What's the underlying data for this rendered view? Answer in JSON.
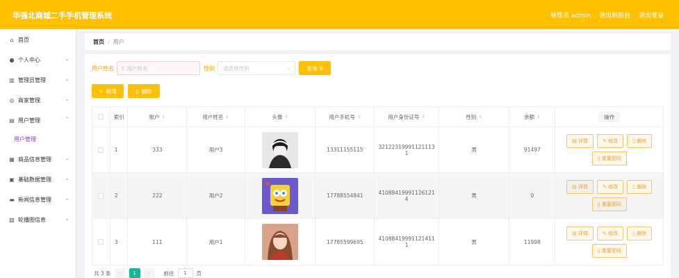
{
  "header": {
    "title": "华强北商城二手手机管理系统",
    "admin": "管理员 admin",
    "to_frontend": "退出到前台",
    "logout": "退出登录"
  },
  "sidebar": {
    "items": [
      {
        "label": "首页",
        "icon": "home-icon"
      },
      {
        "label": "个人中心",
        "icon": "user-icon"
      },
      {
        "label": "管理员管理",
        "icon": "bank-icon"
      },
      {
        "label": "商家管理",
        "icon": "compass-icon"
      },
      {
        "label": "用户管理",
        "icon": "trash-icon",
        "sub": "用户管理"
      },
      {
        "label": "商品信息管理",
        "icon": "grid-icon"
      },
      {
        "label": "基础数据管理",
        "icon": "list-icon"
      },
      {
        "label": "新闻信息管理",
        "icon": "chat-icon"
      },
      {
        "label": "轮播图信息",
        "icon": "document-icon"
      }
    ]
  },
  "breadcrumb": {
    "home": "首页",
    "sep": "/",
    "current": "用户"
  },
  "search": {
    "name_label": "用户姓名",
    "name_placeholder": "用户姓名",
    "gender_label": "性别",
    "gender_placeholder": "请选择性别",
    "query_button": "查询"
  },
  "actions": {
    "add": "新增",
    "delete": "删除"
  },
  "table": {
    "headers": {
      "index": "索引",
      "account": "账户",
      "name": "用户姓名",
      "avatar": "头像",
      "phone": "用户手机号",
      "idcard": "用户身份证号",
      "gender": "性别",
      "balance": "余额",
      "ops": "操作"
    },
    "op_labels": {
      "detail": "详情",
      "edit": "修改",
      "delete": "删除",
      "reset": "重置密码"
    },
    "rows": [
      {
        "index": "1",
        "account": "333",
        "name": "用户3",
        "phone": "13311155115",
        "idcard": "321223199911211131",
        "gender": "男",
        "balance": "91497"
      },
      {
        "index": "2",
        "account": "222",
        "name": "用户2",
        "phone": "17788554841",
        "idcard": "410884199911261214",
        "gender": "男",
        "balance": "0"
      },
      {
        "index": "3",
        "account": "111",
        "name": "用户1",
        "phone": "17785599695",
        "idcard": "410884199911214111",
        "gender": "男",
        "balance": "11998"
      }
    ]
  },
  "pagination": {
    "total": "共 3 条",
    "prev": "‹",
    "page": "1",
    "next": "›",
    "goto": "前往",
    "goto_value": "1",
    "page_unit": "页"
  },
  "colors": {
    "accent": "#ffc000",
    "submenu": "#8e44ad",
    "pager_active": "#11b89a"
  }
}
